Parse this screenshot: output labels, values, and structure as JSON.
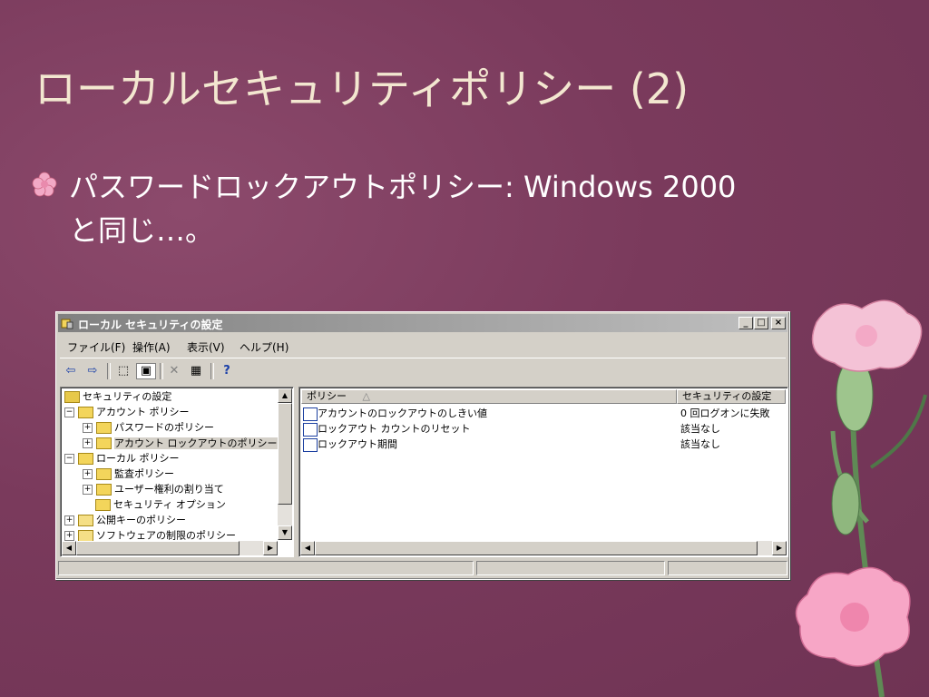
{
  "slide": {
    "title": "ローカルセキュリティポリシー (2)",
    "bullet_line1": "パスワードロックアウトポリシー: Windows 2000",
    "bullet_line2": "と同じ…。"
  },
  "window": {
    "title": "ローカル セキュリティの設定",
    "controls": {
      "minimize": "_",
      "maximize": "□",
      "close": "×"
    },
    "menu": [
      "ファイル(F)",
      "操作(A)",
      "表示(V)",
      "ヘルプ(H)"
    ],
    "toolbar": {
      "back": "⇦",
      "forward": "⇨",
      "up": "⬚",
      "show_tree": "▣",
      "delete": "✕",
      "export": "▦",
      "help": "?"
    },
    "tree": [
      {
        "label": "セキュリティの設定",
        "expander": "",
        "level": 0,
        "icon": "security-root-icon"
      },
      {
        "label": "アカウント ポリシー",
        "expander": "−",
        "level": 1,
        "icon": "folder-locked-icon"
      },
      {
        "label": "パスワードのポリシー",
        "expander": "+",
        "level": 2,
        "icon": "folder-locked-icon"
      },
      {
        "label": "アカウント ロックアウトのポリシー",
        "expander": "+",
        "level": 2,
        "icon": "folder-locked-icon",
        "selected": true
      },
      {
        "label": "ローカル ポリシー",
        "expander": "−",
        "level": 1,
        "icon": "folder-locked-icon"
      },
      {
        "label": "監査ポリシー",
        "expander": "+",
        "level": 2,
        "icon": "folder-locked-icon"
      },
      {
        "label": "ユーザー権利の割り当て",
        "expander": "+",
        "level": 2,
        "icon": "folder-locked-icon"
      },
      {
        "label": "セキュリティ オプション",
        "expander": "",
        "level": 2,
        "icon": "folder-locked-icon"
      },
      {
        "label": "公開キーのポリシー",
        "expander": "+",
        "level": 1,
        "icon": "folder-icon"
      },
      {
        "label": "ソフトウェアの制限のポリシー",
        "expander": "+",
        "level": 1,
        "icon": "folder-icon"
      }
    ],
    "list": {
      "col_policy": "ポリシー",
      "sort_mark": "△",
      "col_setting": "セキュリティの設定",
      "rows": [
        {
          "policy": "アカウントのロックアウトのしきい値",
          "setting": "0 回ログオンに失敗"
        },
        {
          "policy": "ロックアウト カウントのリセット",
          "setting": "該当なし"
        },
        {
          "policy": "ロックアウト期間",
          "setting": "該当なし"
        }
      ]
    },
    "scroll": {
      "up": "▲",
      "down": "▼",
      "left": "◀",
      "right": "▶"
    }
  },
  "colors": {
    "background": "#7a3a5c",
    "title_text": "#f3e7d0",
    "body_text": "#ffffff",
    "window_face": "#d4d0c8"
  }
}
